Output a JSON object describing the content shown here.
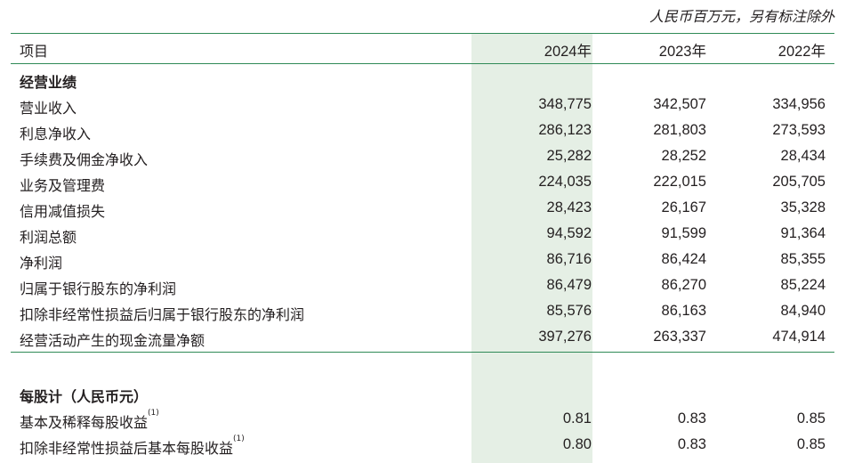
{
  "unit_note": "人民币百万元，另有标注除外",
  "header": {
    "item_label": "项目",
    "years": [
      "2024年",
      "2023年",
      "2022年"
    ]
  },
  "sections": [
    {
      "title": "经营业绩",
      "rows": [
        {
          "label": "营业收入",
          "values": [
            "348,775",
            "342,507",
            "334,956"
          ]
        },
        {
          "label": "利息净收入",
          "values": [
            "286,123",
            "281,803",
            "273,593"
          ]
        },
        {
          "label": "手续费及佣金净收入",
          "values": [
            "25,282",
            "28,252",
            "28,434"
          ]
        },
        {
          "label": "业务及管理费",
          "values": [
            "224,035",
            "222,015",
            "205,705"
          ]
        },
        {
          "label": "信用减值损失",
          "values": [
            "28,423",
            "26,167",
            "35,328"
          ]
        },
        {
          "label": "利润总额",
          "values": [
            "94,592",
            "91,599",
            "91,364"
          ]
        },
        {
          "label": "净利润",
          "values": [
            "86,716",
            "86,424",
            "85,355"
          ]
        },
        {
          "label": "归属于银行股东的净利润",
          "values": [
            "86,479",
            "86,270",
            "85,224"
          ]
        },
        {
          "label": "扣除非经常性损益后归属于银行股东的净利润",
          "values": [
            "85,576",
            "86,163",
            "84,940"
          ]
        },
        {
          "label": "经营活动产生的现金流量净额",
          "values": [
            "397,276",
            "263,337",
            "474,914"
          ]
        }
      ]
    },
    {
      "title": "每股计（人民币元）",
      "rows": [
        {
          "label": "基本及稀释每股收益",
          "note": "(1)",
          "values": [
            "0.81",
            "0.83",
            "0.85"
          ]
        },
        {
          "label": "扣除非经常性损益后基本每股收益",
          "note": "(1)",
          "values": [
            "0.80",
            "0.83",
            "0.85"
          ]
        }
      ]
    }
  ],
  "colors": {
    "rule": "#2f8a57",
    "highlight_column": "#e5efe5",
    "text": "#231f20"
  }
}
